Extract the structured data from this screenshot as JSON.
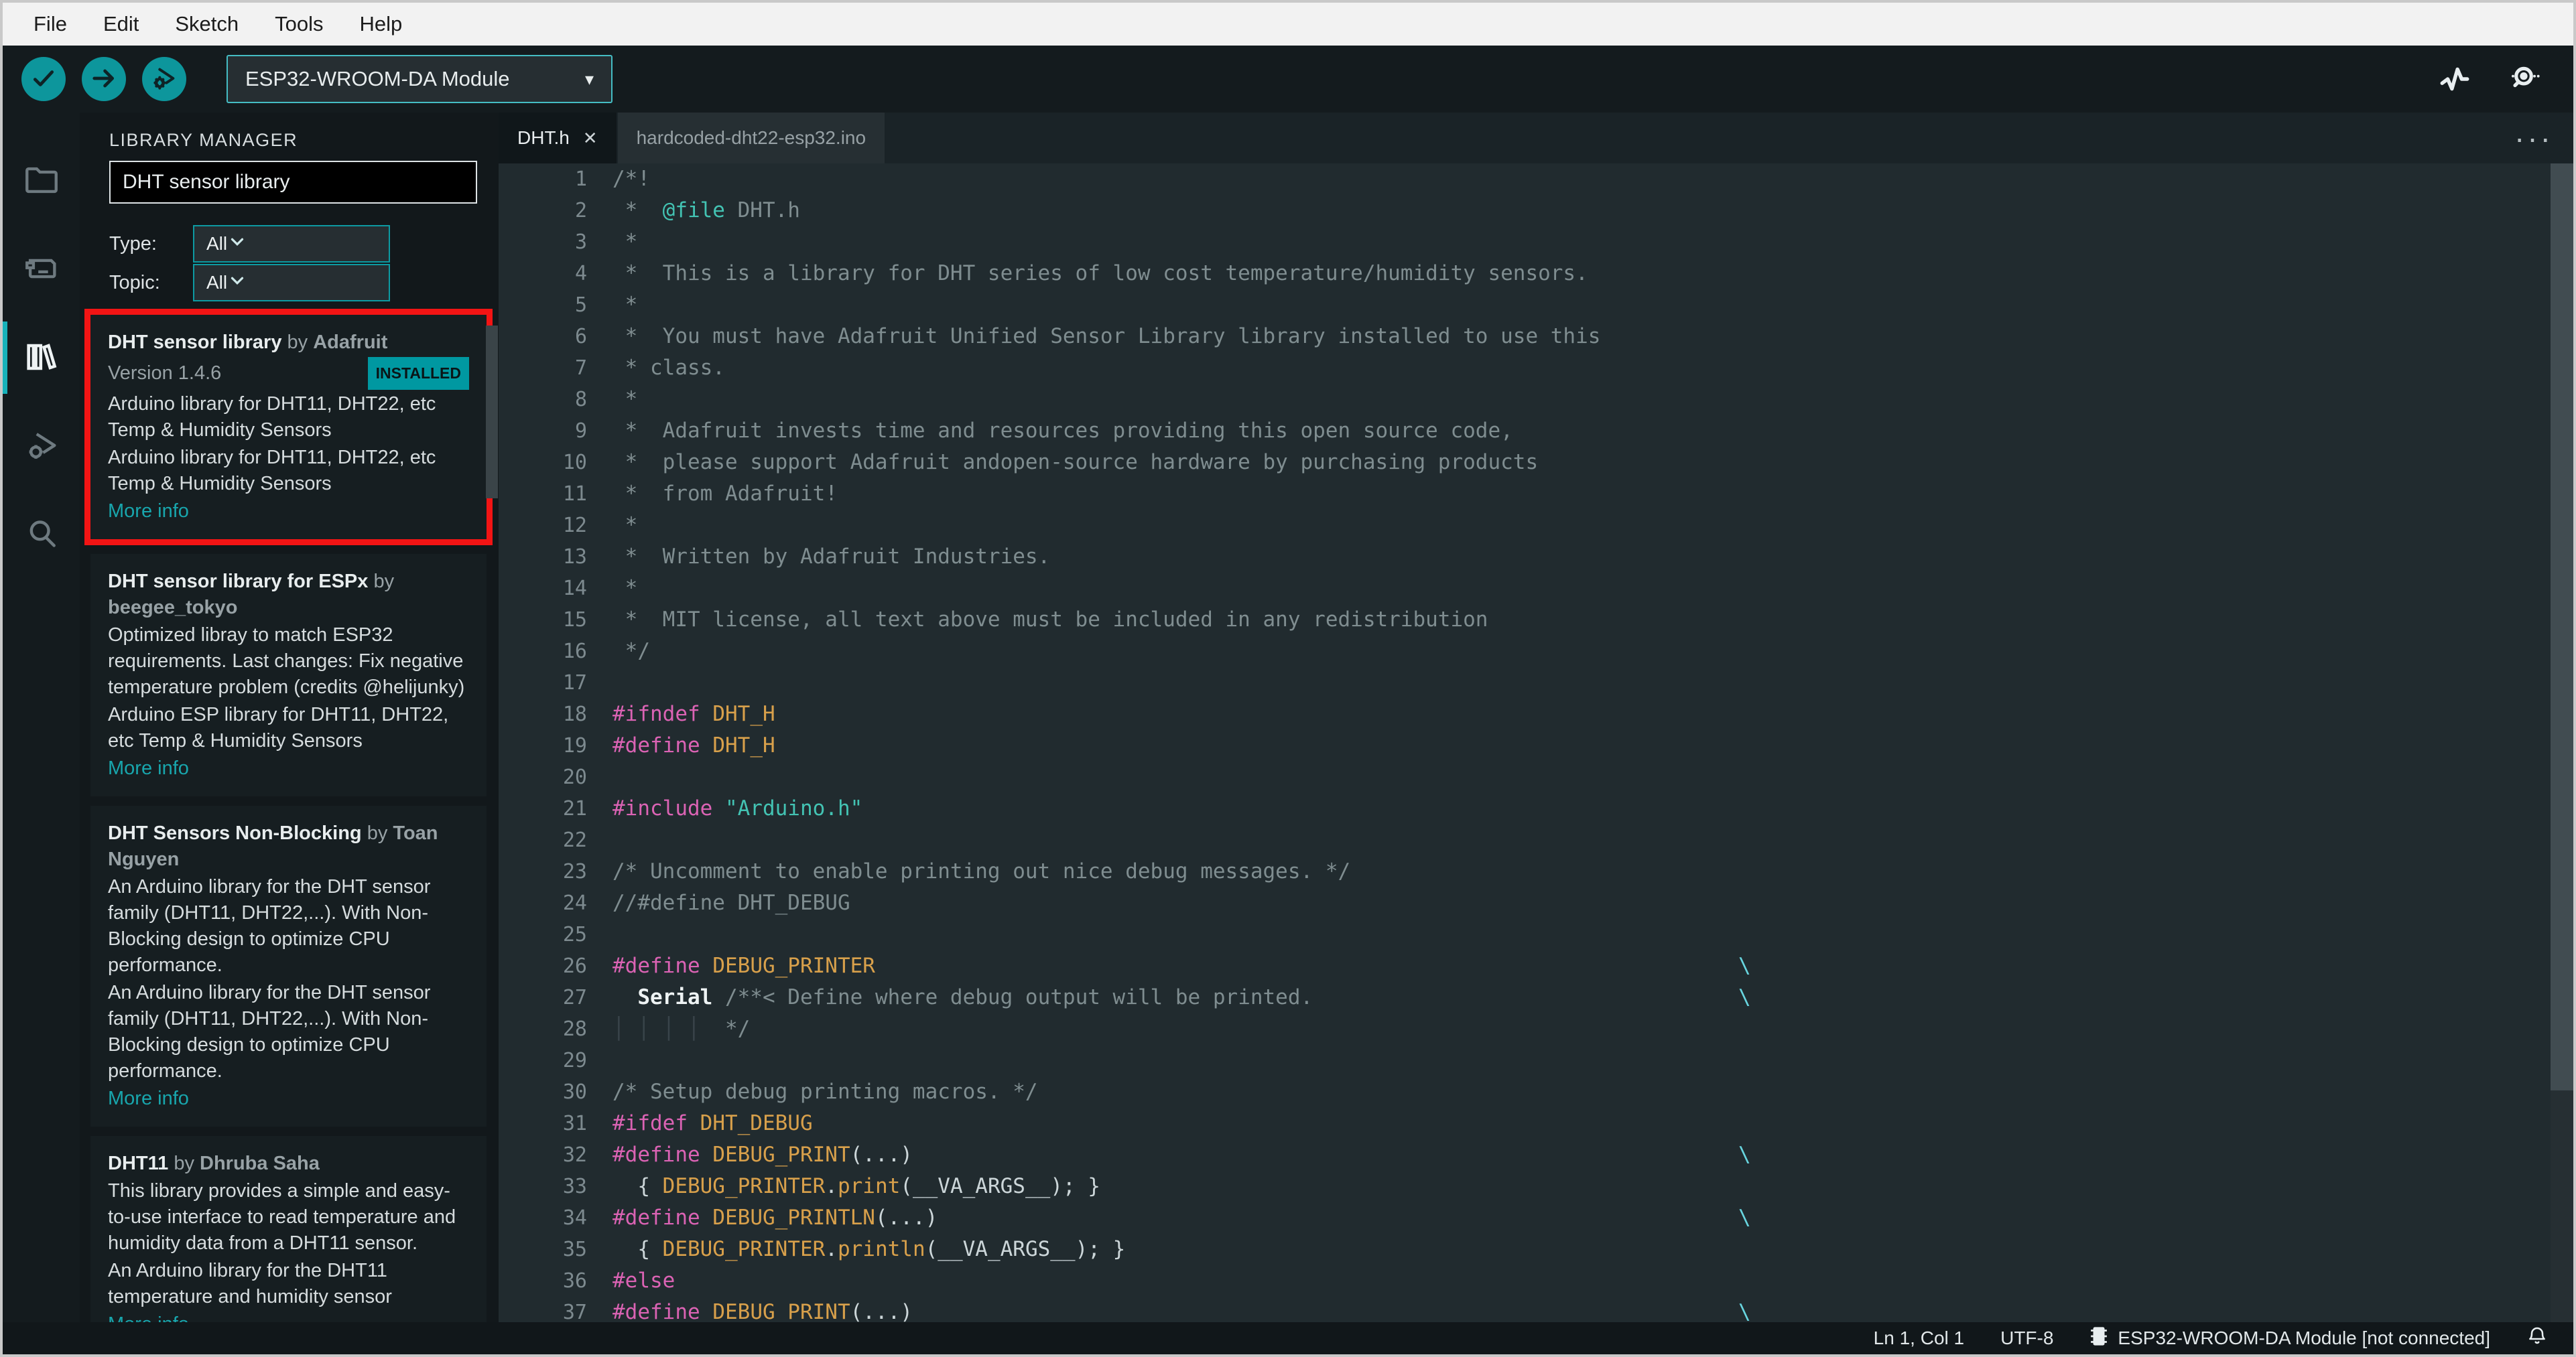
{
  "colors": {
    "accent_teal": "#0d969c",
    "badge_teal": "#0098a1",
    "highlight_red": "#f21414",
    "link_teal": "#18a6ad"
  },
  "menu_bar": {
    "items": [
      "File",
      "Edit",
      "Sketch",
      "Tools",
      "Help"
    ]
  },
  "toolbar": {
    "board": "ESP32-WROOM-DA Module",
    "caret": "▾"
  },
  "sidebar": {
    "items": [
      "sketchbook",
      "boards-manager",
      "library-manager",
      "debugger",
      "search"
    ],
    "active": "library-manager"
  },
  "library_manager": {
    "title": "LIBRARY MANAGER",
    "search_value": "DHT sensor library",
    "filters": [
      {
        "label": "Type:",
        "value": "All"
      },
      {
        "label": "Topic:",
        "value": "All"
      }
    ],
    "entries": [
      {
        "name": "DHT sensor library",
        "by": "by",
        "author": "Adafruit",
        "version": "Version 1.4.6",
        "badge": "INSTALLED",
        "highlighted": true,
        "desc": [
          "Arduino library for DHT11, DHT22, etc Temp & Humidity Sensors",
          "Arduino library for DHT11, DHT22, etc Temp & Humidity Sensors"
        ],
        "more": "More info"
      },
      {
        "name": "DHT sensor library for ESPx",
        "by": "by",
        "author": "beegee_tokyo",
        "version": "",
        "badge": "",
        "highlighted": false,
        "desc": [
          "Optimized libray to match ESP32 requirements. Last changes: Fix negative temperature problem (credits @helijunky)",
          "Arduino ESP library for DHT11, DHT22, etc Temp & Humidity Sensors"
        ],
        "more": "More info"
      },
      {
        "name": "DHT Sensors Non-Blocking",
        "by": "by",
        "author": "Toan Nguyen",
        "version": "",
        "badge": "",
        "highlighted": false,
        "desc": [
          "An Arduino library for the DHT sensor family (DHT11, DHT22,...). With Non-Blocking design to optimize CPU performance.",
          "An Arduino library for the DHT sensor family (DHT11, DHT22,...). With Non-Blocking design to optimize CPU performance."
        ],
        "more": "More info"
      },
      {
        "name": "DHT11",
        "by": "by",
        "author": "Dhruba Saha",
        "version": "",
        "badge": "",
        "highlighted": false,
        "desc": [
          "This library provides a simple and easy-to-use interface to read temperature and humidity data from a DHT11 sensor.",
          "An Arduino library for the DHT11 temperature and humidity sensor"
        ],
        "more": "More info"
      }
    ]
  },
  "tabs": [
    {
      "label": "DHT.h",
      "close": "✕",
      "active": true
    },
    {
      "label": "hardcoded-dht22-esp32.ino",
      "active": false
    }
  ],
  "editor": {
    "more_glyph": "···",
    "continuation": "\\",
    "lines": [
      {
        "n": 1,
        "t": [
          [
            "/*!",
            "cm"
          ]
        ]
      },
      {
        "n": 2,
        "t": [
          [
            " *  ",
            "cm"
          ],
          [
            "@file",
            "at"
          ],
          [
            " DHT.h",
            "cm"
          ]
        ]
      },
      {
        "n": 3,
        "t": [
          [
            " *",
            "cm"
          ]
        ]
      },
      {
        "n": 4,
        "t": [
          [
            " *  This is a library for DHT series of low cost temperature/humidity sensors.",
            "cm"
          ]
        ]
      },
      {
        "n": 5,
        "t": [
          [
            " *",
            "cm"
          ]
        ]
      },
      {
        "n": 6,
        "t": [
          [
            " *  You must have Adafruit Unified Sensor Library library installed to use this",
            "cm"
          ]
        ]
      },
      {
        "n": 7,
        "t": [
          [
            " * class.",
            "cm"
          ]
        ]
      },
      {
        "n": 8,
        "t": [
          [
            " *",
            "cm"
          ]
        ]
      },
      {
        "n": 9,
        "t": [
          [
            " *  Adafruit invests time and resources providing this open source code,",
            "cm"
          ]
        ]
      },
      {
        "n": 10,
        "t": [
          [
            " *  please support Adafruit andopen-source hardware by purchasing products",
            "cm"
          ]
        ]
      },
      {
        "n": 11,
        "t": [
          [
            " *  from Adafruit!",
            "cm"
          ]
        ]
      },
      {
        "n": 12,
        "t": [
          [
            " *",
            "cm"
          ]
        ]
      },
      {
        "n": 13,
        "t": [
          [
            " *  Written by Adafruit Industries.",
            "cm"
          ]
        ]
      },
      {
        "n": 14,
        "t": [
          [
            " *",
            "cm"
          ]
        ]
      },
      {
        "n": 15,
        "t": [
          [
            " *  MIT license, all text above must be included in any redistribution",
            "cm"
          ]
        ]
      },
      {
        "n": 16,
        "t": [
          [
            " */",
            "cm"
          ]
        ]
      },
      {
        "n": 17,
        "t": []
      },
      {
        "n": 18,
        "t": [
          [
            "#ifndef",
            "pp"
          ],
          [
            " ",
            "pl"
          ],
          [
            "DHT_H",
            "mc"
          ]
        ]
      },
      {
        "n": 19,
        "t": [
          [
            "#define",
            "pp"
          ],
          [
            " ",
            "pl"
          ],
          [
            "DHT_H",
            "mc"
          ]
        ]
      },
      {
        "n": 20,
        "t": []
      },
      {
        "n": 21,
        "t": [
          [
            "#include",
            "pp"
          ],
          [
            " ",
            "pl"
          ],
          [
            "\"Arduino.h\"",
            "st"
          ]
        ]
      },
      {
        "n": 22,
        "t": []
      },
      {
        "n": 23,
        "t": [
          [
            "/* Uncomment to enable printing out nice debug messages. */",
            "cm"
          ]
        ]
      },
      {
        "n": 24,
        "t": [
          [
            "//#define DHT_DEBUG",
            "cm"
          ]
        ]
      },
      {
        "n": 25,
        "t": []
      },
      {
        "n": 26,
        "t": [
          [
            "#define",
            "pp"
          ],
          [
            " ",
            "pl"
          ],
          [
            "DEBUG_PRINTER",
            "mc"
          ]
        ],
        "bs": true
      },
      {
        "n": 27,
        "t": [
          [
            "  ",
            "pl"
          ],
          [
            "Serial",
            "kw"
          ],
          [
            " ",
            "pl"
          ],
          [
            "/**< Define where debug output will be printed.",
            "cm"
          ]
        ],
        "bs": true
      },
      {
        "n": 28,
        "t": [
          [
            "│ │ │ │ ",
            "gd"
          ],
          [
            " */",
            "cm"
          ]
        ]
      },
      {
        "n": 29,
        "t": []
      },
      {
        "n": 30,
        "t": [
          [
            "/* Setup debug printing macros. */",
            "cm"
          ]
        ]
      },
      {
        "n": 31,
        "t": [
          [
            "#ifdef",
            "pp"
          ],
          [
            " ",
            "pl"
          ],
          [
            "DHT_DEBUG",
            "mc"
          ]
        ]
      },
      {
        "n": 32,
        "t": [
          [
            "#define",
            "pp"
          ],
          [
            " ",
            "pl"
          ],
          [
            "DEBUG_PRINT",
            "mc"
          ],
          [
            "(...)",
            "pl"
          ]
        ],
        "bs": true
      },
      {
        "n": 33,
        "t": [
          [
            "  { ",
            "pl"
          ],
          [
            "DEBUG_PRINTER",
            "mc"
          ],
          [
            ".",
            "pl"
          ],
          [
            "print",
            "mc"
          ],
          [
            "(",
            "pl"
          ],
          [
            "__VA_ARGS__",
            "pl"
          ],
          [
            "); }",
            "pl"
          ]
        ]
      },
      {
        "n": 34,
        "t": [
          [
            "#define",
            "pp"
          ],
          [
            " ",
            "pl"
          ],
          [
            "DEBUG_PRINTLN",
            "mc"
          ],
          [
            "(...)",
            "pl"
          ]
        ],
        "bs": true
      },
      {
        "n": 35,
        "t": [
          [
            "  { ",
            "pl"
          ],
          [
            "DEBUG_PRINTER",
            "mc"
          ],
          [
            ".",
            "pl"
          ],
          [
            "println",
            "mc"
          ],
          [
            "(",
            "pl"
          ],
          [
            "__VA_ARGS__",
            "pl"
          ],
          [
            "); }",
            "pl"
          ]
        ]
      },
      {
        "n": 36,
        "t": [
          [
            "#else",
            "pp"
          ]
        ]
      },
      {
        "n": 37,
        "t": [
          [
            "#define",
            "pp"
          ],
          [
            " ",
            "pl"
          ],
          [
            "DEBUG_PRINT",
            "mc"
          ],
          [
            "(...)",
            "pl"
          ]
        ],
        "bs": true
      }
    ]
  },
  "status_bar": {
    "position": "Ln 1, Col 1",
    "encoding": "UTF-8",
    "board": "ESP32-WROOM-DA Module [not connected]"
  }
}
